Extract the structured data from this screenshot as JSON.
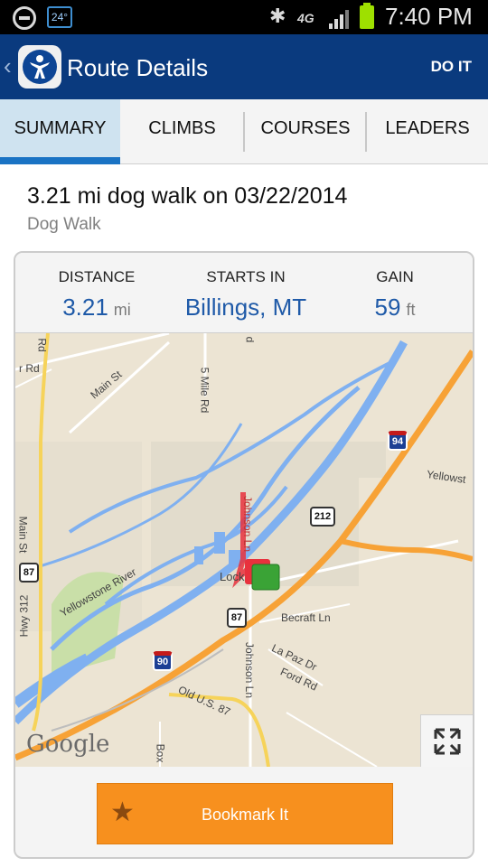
{
  "status_bar": {
    "temperature": "24°",
    "network": "4G",
    "time": "7:40 PM"
  },
  "app_bar": {
    "back_glyph": "‹",
    "title": "Route Details",
    "action": "DO IT"
  },
  "tabs": [
    {
      "label": "SUMMARY",
      "active": true
    },
    {
      "label": "CLIMBS",
      "active": false
    },
    {
      "label": "COURSES",
      "active": false
    },
    {
      "label": "LEADERS",
      "active": false
    }
  ],
  "route": {
    "title": "3.21 mi dog walk on 03/22/2014",
    "type": "Dog Walk"
  },
  "stats": {
    "distance": {
      "label": "DISTANCE",
      "value": "3.21",
      "unit": "mi"
    },
    "starts_in": {
      "label": "STARTS IN",
      "value": "Billings, MT"
    },
    "gain": {
      "label": "GAIN",
      "value": "59",
      "unit": "ft"
    }
  },
  "map": {
    "attribution": "Google",
    "labels": {
      "main_st": "Main St",
      "five_mile_rd": "5 Mile Rd",
      "yellowstone": "Yellowst",
      "yellowstone_river": "Yellowstone River",
      "main_st_vertical": "Main St",
      "hwy_312": "Hwy 312",
      "johnson_ln": "Johnson Ln",
      "johnson_ln_2": "Johnson Ln",
      "lock": "Lock",
      "becraft_ln": "Becraft Ln",
      "la_paz": "La Paz Dr",
      "ford_rd": "Ford Rd",
      "old_us_87": "Old U.S. 87",
      "box": "Box",
      "rd_top_left": "Rd",
      "rd_top_left_2": "r Rd",
      "d_top": "d"
    },
    "shields": {
      "i94": "94",
      "us212": "212",
      "us87_left": "87",
      "us87_center": "87",
      "i90": "90"
    },
    "colors": {
      "water": "#7fb0f0",
      "highway": "#f7a236",
      "route": "#e8313d",
      "end_marker": "#3aa336"
    },
    "icons": [
      "expand-icon",
      "end-flag-icon"
    ]
  },
  "actions": {
    "bookmark": "Bookmark It",
    "bookmark_icon": "star-icon"
  },
  "theme": {
    "primary": "#0a3a7e",
    "accent": "#1a73c4",
    "bookmark": "#f7901e"
  }
}
